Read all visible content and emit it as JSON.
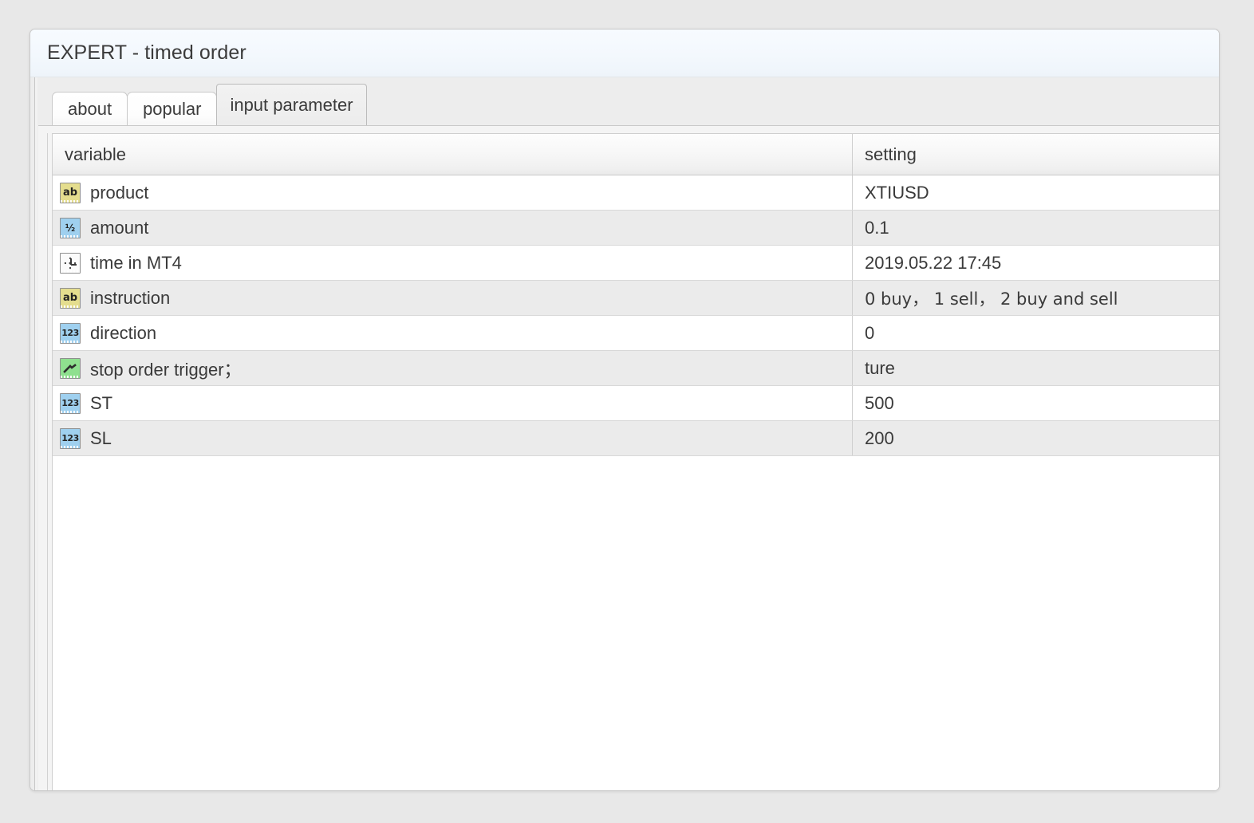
{
  "window": {
    "title": "EXPERT - timed order"
  },
  "tabs": [
    {
      "label": "about",
      "active": false
    },
    {
      "label": "popular",
      "active": false
    },
    {
      "label": "input parameter",
      "active": true
    }
  ],
  "table": {
    "headers": {
      "variable": "variable",
      "setting": "setting"
    },
    "rows": [
      {
        "icon": "string-type-icon",
        "icon_glyph": "ab",
        "variable": "product",
        "setting": "XTIUSD"
      },
      {
        "icon": "double-type-icon",
        "icon_glyph": "½",
        "variable": "amount",
        "setting": "0.1"
      },
      {
        "icon": "datetime-type-icon",
        "icon_glyph": "",
        "variable": "time in MT4",
        "setting": "2019.05.22 17:45"
      },
      {
        "icon": "string-type-icon",
        "icon_glyph": "ab",
        "variable": "instruction",
        "setting": "0 buy， 1 sell， 2 buy and sell"
      },
      {
        "icon": "integer-type-icon",
        "icon_glyph": "123",
        "variable": "direction",
        "setting": "0"
      },
      {
        "icon": "boolean-type-icon",
        "icon_glyph": "",
        "variable": "stop order trigger；",
        "setting": "ture"
      },
      {
        "icon": "integer-type-icon",
        "icon_glyph": "123",
        "variable": "ST",
        "setting": "500"
      },
      {
        "icon": "integer-type-icon",
        "icon_glyph": "123",
        "variable": "SL",
        "setting": "200"
      }
    ]
  },
  "colors": {
    "string_icon": "#e4dd8e",
    "numeric_icon": "#9fd0ef",
    "boolean_icon": "#8fe08f",
    "titlebar": "#f3f8fd",
    "row_alt": "#ebebeb",
    "text": "#3a3a3a"
  }
}
